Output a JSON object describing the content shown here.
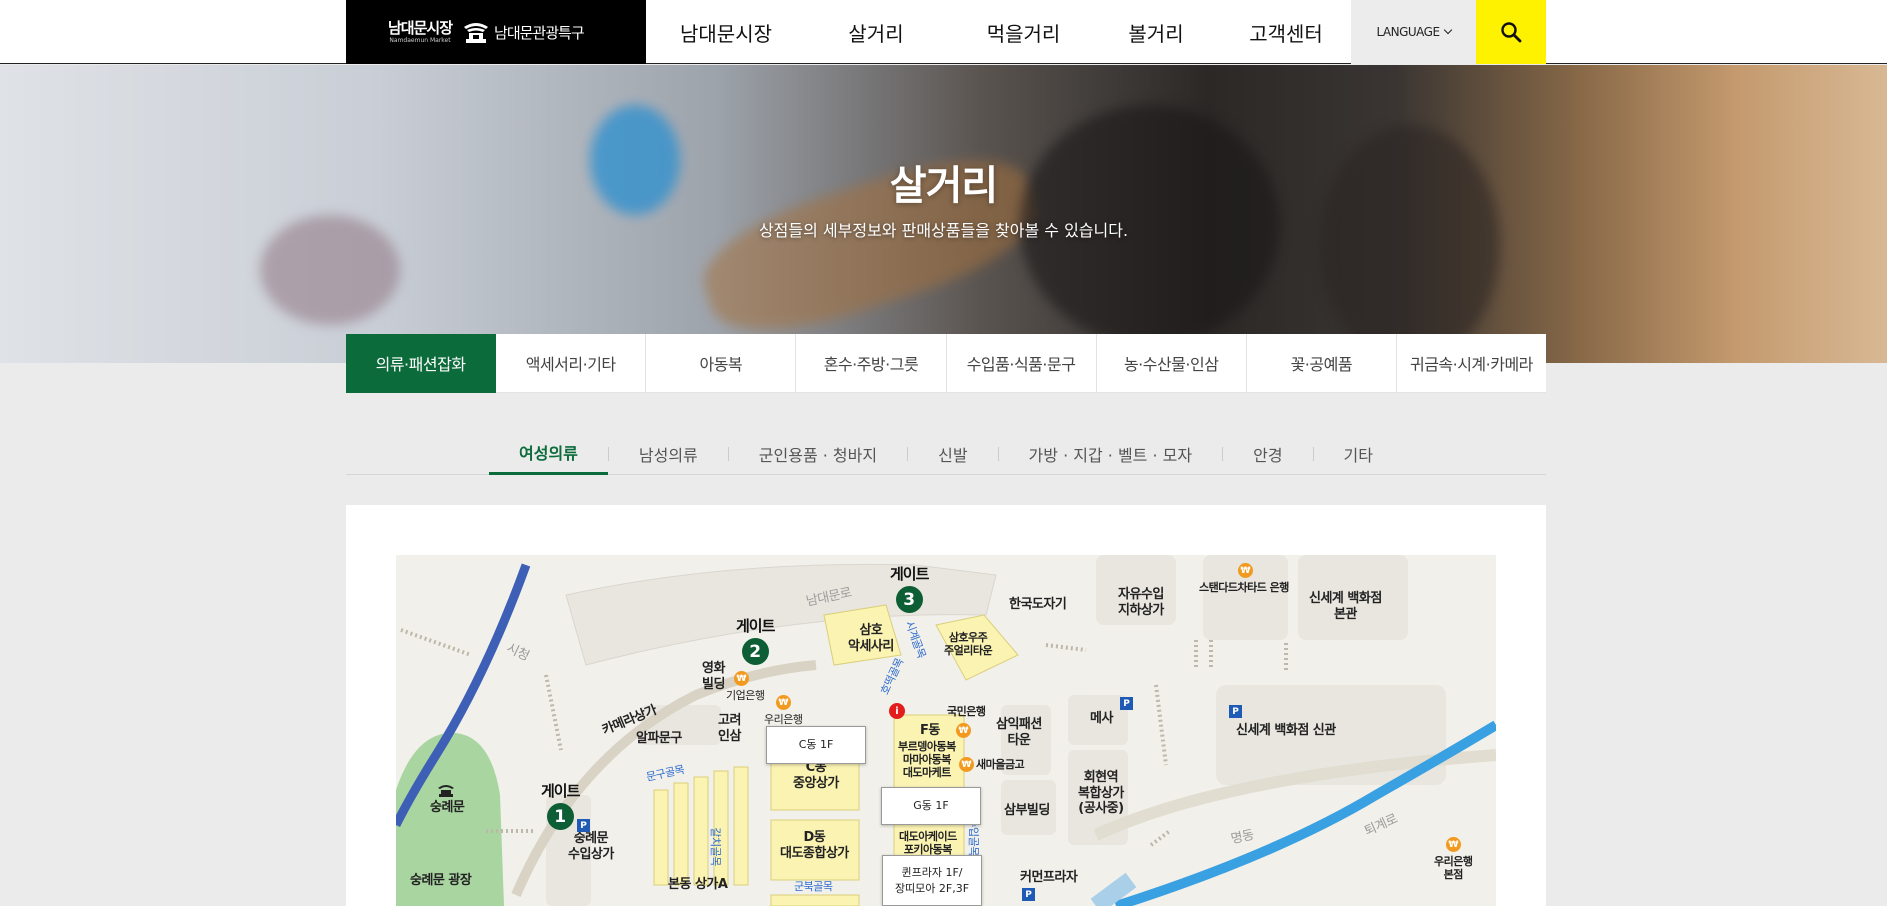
{
  "header": {
    "brand_ko": "남대문시장",
    "brand_en": "Namdaemun Market",
    "brand_district": "남대문관광특구",
    "nav": [
      "남대문시장",
      "살거리",
      "먹을거리",
      "볼거리",
      "고객센터"
    ],
    "language_label": "LANGUAGE",
    "search_icon": "search-icon"
  },
  "hero": {
    "title": "살거리",
    "subtitle": "상점들의 세부정보와 판매상품들을 찾아볼 수 있습니다."
  },
  "category_tabs": [
    "의류·패션잡화",
    "액세서리·기타",
    "아동복",
    "혼수·주방·그릇",
    "수입품·식품·문구",
    "농·수산물·인삼",
    "꽃·공예품",
    "귀금속·시계·카메라"
  ],
  "sub_tabs": [
    "여성의류",
    "남성의류",
    "군인용품 · 청바지",
    "신발",
    "가방 · 지갑 · 벨트 · 모자",
    "안경",
    "기타"
  ],
  "colors": {
    "brand_green": "#0b6b3a",
    "gate_green": "#0d5e35",
    "search_yellow": "#fff200",
    "map_building_yellow": "#fbf3b2",
    "map_road_blue": "#3d5fb6",
    "map_river_blue": "#39a0e2",
    "map_park_green": "#a8d5a0"
  },
  "map": {
    "gates": [
      {
        "label": "게이트",
        "num": "1"
      },
      {
        "label": "게이트",
        "num": "2"
      },
      {
        "label": "게이트",
        "num": "3"
      }
    ],
    "labels": {
      "namdaemun_ro": "남대문로",
      "sicheong": "시청",
      "myeongdong": "명동",
      "toegye_ro": "퇴계로",
      "camera": "카메라상가",
      "alpa": "알파문구",
      "goryeo": "고려\n인삼",
      "younghwa": "영화\n빌딩",
      "ibk": "기업은행",
      "woori1": "우리은행",
      "samho": "삼호\n악세사리",
      "samho_uju": "삼호우주\n주얼리타운",
      "hanguk": "한국도자기",
      "jayu": "자유수입\n지하상가",
      "standard": "스탠다드차타드 은행",
      "shinsegae_main": "신세계 백화점\n본관",
      "shinsegae_new": "신세계 백화점 신관",
      "kookmin": "국민은행",
      "fdong": "F동",
      "fdong_shops": "부르뎅아동복\n마마아동복\n대도마케트",
      "saemaeul": "새마을금고",
      "samik": "삼익패션\n타운",
      "mesa": "메사",
      "hoehyeon": "회현역\n복합상가\n(공사중)",
      "cdong": "C동\n중앙상가",
      "ddong": "D동\n대도종합상가",
      "sambu": "삼부빌딩",
      "daedo_arcade": "대도아케이드\n포키아동복",
      "sungnyemun": "숭례문",
      "sungnyemun_sq": "숭례문 광장",
      "sungnyemun_import": "숭례문\n수입상가",
      "bondong": "본동 상가A",
      "common": "커먼프라자",
      "woori2": "우리은행\n본점",
      "mungu_alley": "문구골목",
      "galchi_alley": "갈치골목",
      "gunbuk_alley": "군북골목",
      "sigye_alley": "시계골목",
      "hoyang_alley": "호떡골목",
      "alley_e": "수입골목"
    },
    "tooltips": [
      "C동 1F",
      "G동 1F",
      "퀸프라자 1F/\n장띠모아 2F,3F"
    ],
    "bank_icon": "won-icon",
    "parking_icon": "parking-icon",
    "info_icon": "info-icon"
  }
}
